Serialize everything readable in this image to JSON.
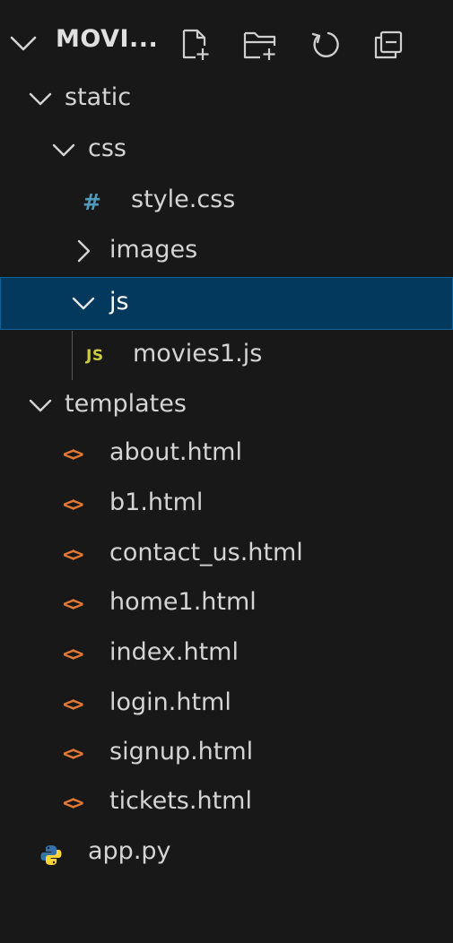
{
  "explorer": {
    "section_title": "MOVI...",
    "actions": {
      "new_file": "new-file-icon",
      "new_folder": "new-folder-icon",
      "refresh": "refresh-icon",
      "collapse_all": "collapse-all-icon"
    },
    "tree": {
      "static": "static",
      "css": "css",
      "style_css": "style.css",
      "images": "images",
      "js": "js",
      "movies1_js": "movies1.js",
      "templates": "templates",
      "about": "about.html",
      "b1": "b1.html",
      "contact_us": "contact_us.html",
      "home1": "home1.html",
      "index": "index.html",
      "login": "login.html",
      "signup": "signup.html",
      "tickets": "tickets.html",
      "app_py": "app.py"
    },
    "badges": {
      "css_glyph": "#",
      "js_glyph": "JS",
      "html_glyph": "<>"
    }
  },
  "colors": {
    "background": "#181818",
    "selected_bg": "#04395e",
    "selected_border": "#0e639c",
    "css_icon": "#519aba",
    "js_icon": "#cbcb41",
    "html_icon": "#e37933",
    "py_icon_blue": "#3572a5",
    "py_icon_yellow": "#ffd43b"
  }
}
